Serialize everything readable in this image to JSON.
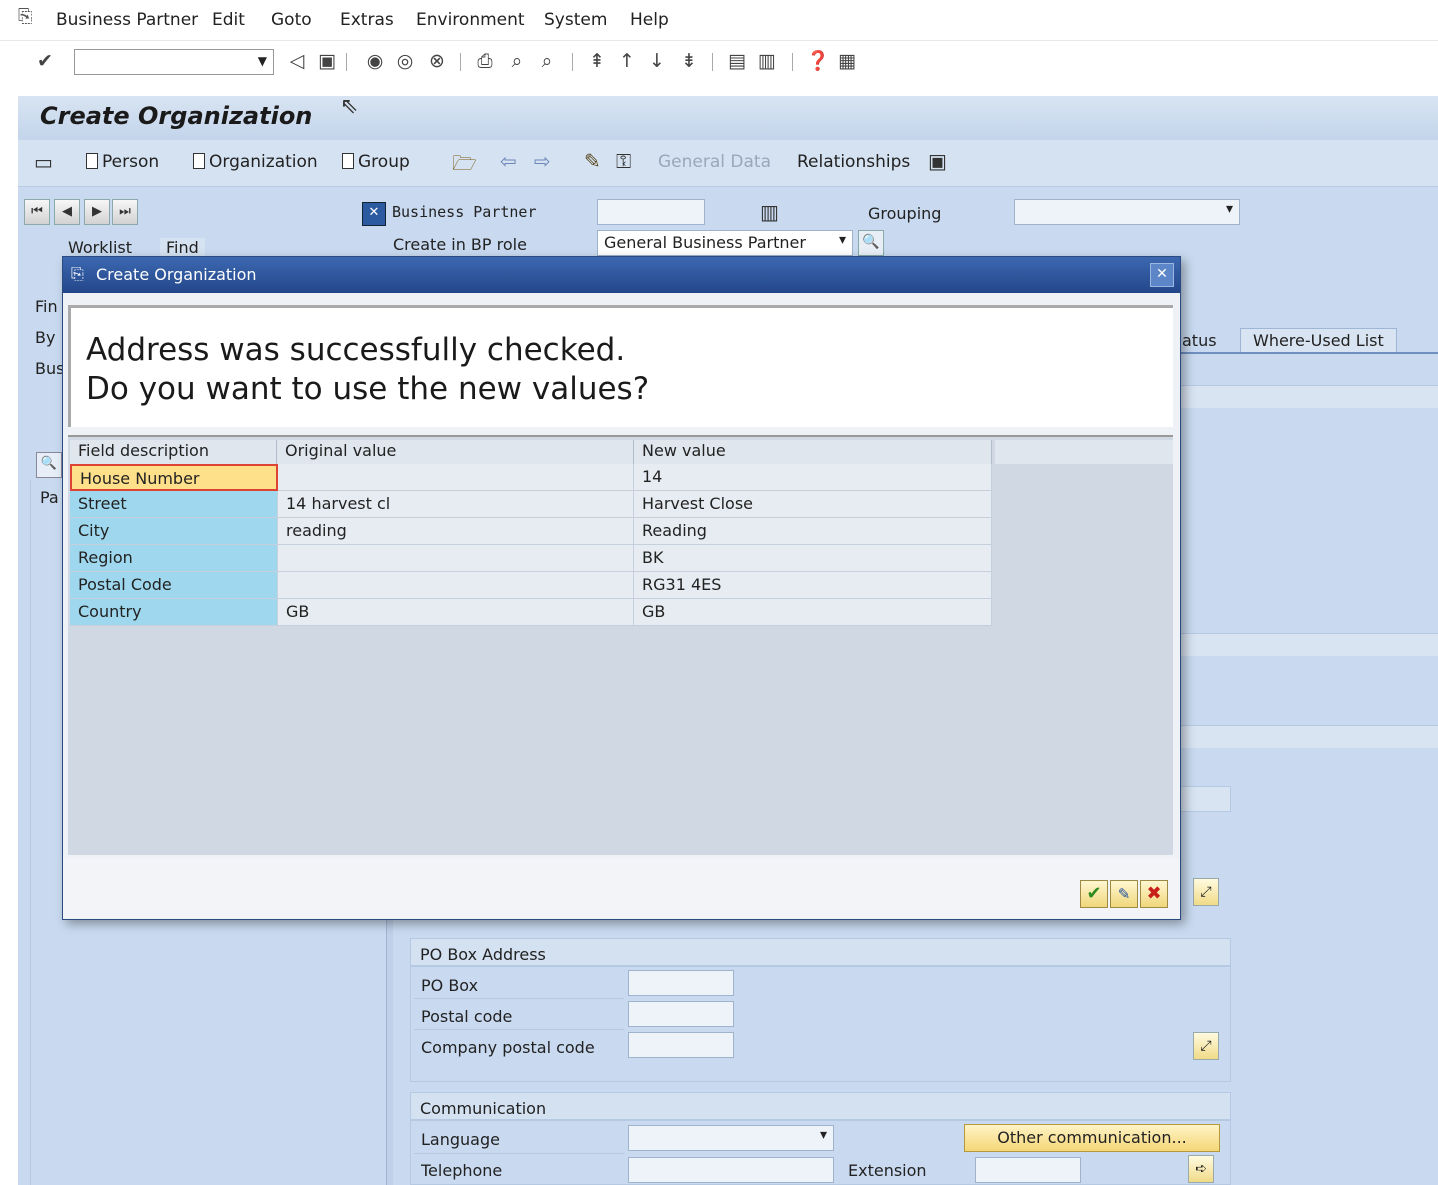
{
  "menubar": {
    "items": [
      {
        "label": "Business Partner",
        "underline": "B"
      },
      {
        "label": "Edit",
        "underline": "E"
      },
      {
        "label": "Goto",
        "underline": "G"
      },
      {
        "label": "Extras",
        "underline": "a"
      },
      {
        "label": "Environment",
        "underline": "v"
      },
      {
        "label": "System",
        "underline": "y"
      },
      {
        "label": "Help",
        "underline": "H"
      }
    ]
  },
  "system_toolbar": {
    "command_field_value": "",
    "icons": [
      "enter-icon",
      "back-icon",
      "save-icon",
      "back-nav-icon",
      "exit-icon",
      "cancel-icon",
      "print-icon",
      "find-icon",
      "find-next-icon",
      "first-page-icon",
      "previous-page-icon",
      "next-page-icon",
      "last-page-icon",
      "create-session-icon",
      "shortcut-icon",
      "help-icon",
      "customize-layout-icon"
    ]
  },
  "app": {
    "title": "Create Organization",
    "toolbar": {
      "person": "Person",
      "organization": "Organization",
      "group": "Group",
      "general_data": "General Data",
      "relationships": "Relationships"
    },
    "header": {
      "business_partner_label": "Business Partner",
      "business_partner_value": "",
      "grouping_label": "Grouping",
      "grouping_value": "",
      "create_in_bp_role_label": "Create in BP role",
      "create_in_bp_role_value": "General Business Partner"
    },
    "left_tabs": [
      "Worklist",
      "Find"
    ],
    "left_labels": [
      "Fin",
      "By",
      "Bus",
      "Pa"
    ],
    "right_tabs": [
      "atus",
      "Where-Used List"
    ]
  },
  "po_box": {
    "title": "PO Box Address",
    "fields": [
      {
        "label": "PO Box",
        "value": ""
      },
      {
        "label": "Postal code",
        "value": ""
      },
      {
        "label": "Company postal code",
        "value": ""
      }
    ]
  },
  "communication": {
    "title": "Communication",
    "language_label": "Language",
    "language_value": "",
    "telephone_label": "Telephone",
    "telephone_value": "",
    "extension_label": "Extension",
    "extension_value": "",
    "other_button": "Other communication..."
  },
  "dialog": {
    "title": "Create Organization",
    "message_line1": "Address was successfully checked.",
    "message_line2": "Do you want to use the new values?",
    "columns": [
      "Field description",
      "Original value",
      "New value"
    ],
    "rows": [
      {
        "field": "House Number",
        "original": "",
        "new": "14"
      },
      {
        "field": "Street",
        "original": "14 harvest cl",
        "new": "Harvest Close"
      },
      {
        "field": "City",
        "original": "reading",
        "new": "Reading"
      },
      {
        "field": "Region",
        "original": "",
        "new": "BK"
      },
      {
        "field": "Postal Code",
        "original": "",
        "new": "RG31 4ES"
      },
      {
        "field": "Country",
        "original": "GB",
        "new": "GB"
      }
    ],
    "buttons": [
      "confirm-icon",
      "edit-icon",
      "cancel-icon"
    ],
    "colors": {
      "title_bar": "#2b4f92",
      "desc_cell": "#9fd8ee",
      "selected_cell": "#ffe08a"
    }
  }
}
